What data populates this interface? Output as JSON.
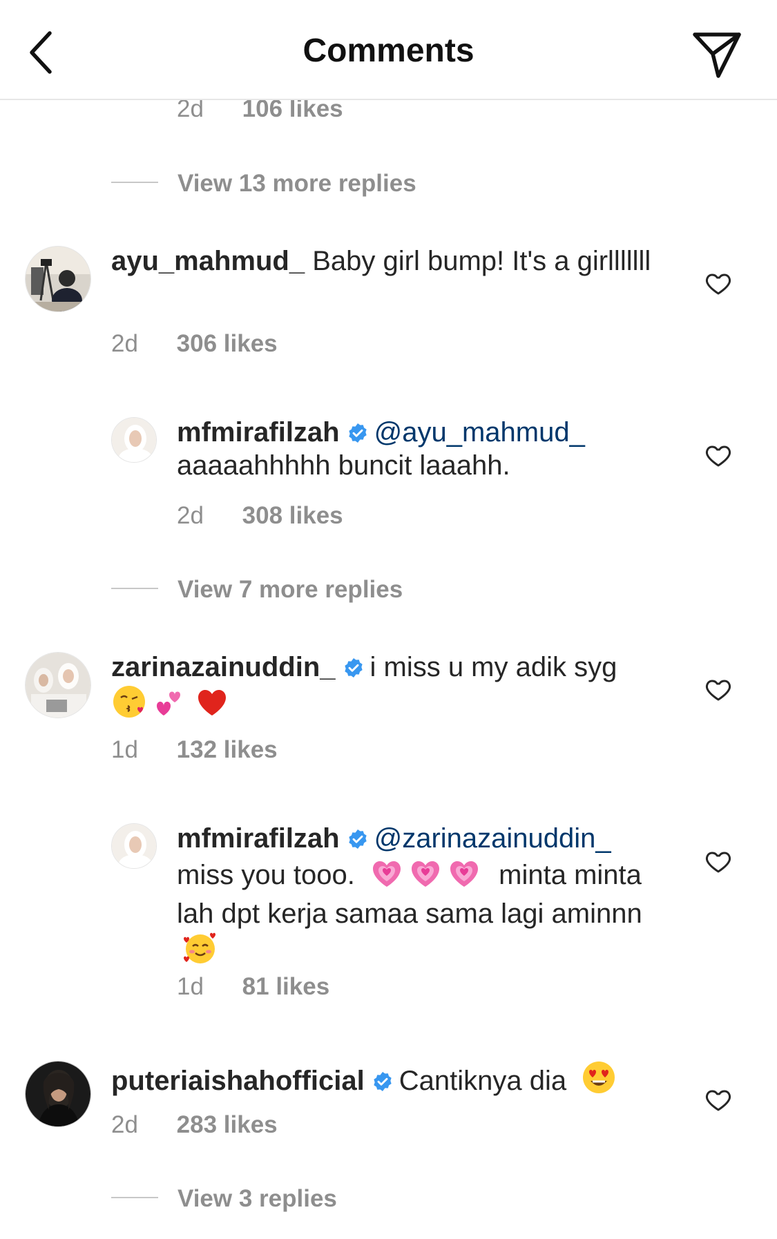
{
  "header": {
    "title": "Comments"
  },
  "comments": {
    "c0": {
      "time": "2d",
      "likes": "106 likes"
    },
    "r0": {
      "label": "View 13 more replies"
    },
    "c1": {
      "user": "ayu_mahmud_",
      "text": "Baby girl bump! It's a girlllllll",
      "time": "2d",
      "likes": "306 likes"
    },
    "c1r1": {
      "user": "mfmirafilzah",
      "mention": "@ayu_mahmud_",
      "text": "aaaaahhhhh buncit laaahh.",
      "time": "2d",
      "likes": "308 likes"
    },
    "r1": {
      "label": "View 7 more replies"
    },
    "c2": {
      "user": "zarinazainuddin_",
      "text": "i miss u my adik syg",
      "time": "1d",
      "likes": "132 likes"
    },
    "c2r1": {
      "user": "mfmirafilzah",
      "mention": "@zarinazainuddin_",
      "text1": "miss you tooo.",
      "text2": "minta minta lah dpt kerja samaa sama lagi aminnn",
      "time": "1d",
      "likes": "81 likes"
    },
    "c3": {
      "user": "puteriaishahofficial",
      "text": "Cantiknya dia",
      "time": "2d",
      "likes": "283 likes"
    },
    "r3": {
      "label": "View 3 replies"
    }
  },
  "colors": {
    "text": "#262626",
    "secondary": "#8e8e8e",
    "mention": "#00376b",
    "verified": "#3897f0",
    "divider": "#e6e6e6"
  },
  "icons": [
    "back-chevron-icon",
    "direct-share-icon",
    "heart-outline-icon",
    "verified-badge-icon"
  ]
}
